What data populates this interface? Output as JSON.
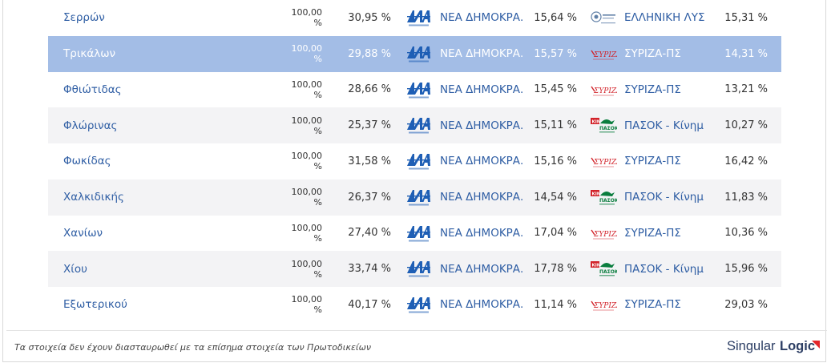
{
  "rows": [
    {
      "region": "Σερρών",
      "counted": "100,00 %",
      "turnout": "30,95 %",
      "first_party": {
        "logo": "nd-logo",
        "name": "ΝΕΑ ΔΗΜΟΚΡΑ...",
        "pct": "15,64 %"
      },
      "second_party": {
        "logo": "elliniki-lysi-logo",
        "name": "ΕΛΛΗΝΙΚΗ ΛΥΣ...",
        "pct": "15,31 %"
      },
      "state": "default"
    },
    {
      "region": "Τρικάλων",
      "counted": "100,00 %",
      "turnout": "29,88 %",
      "first_party": {
        "logo": "nd-logo",
        "name": "ΝΕΑ ΔΗΜΟΚΡΑ...",
        "pct": "15,57 %"
      },
      "second_party": {
        "logo": "syriza-logo",
        "name": "ΣΥΡΙΖΑ-ΠΣ",
        "pct": "14,31 %"
      },
      "state": "selected"
    },
    {
      "region": "Φθιώτιδας",
      "counted": "100,00 %",
      "turnout": "28,66 %",
      "first_party": {
        "logo": "nd-logo",
        "name": "ΝΕΑ ΔΗΜΟΚΡΑ...",
        "pct": "15,45 %"
      },
      "second_party": {
        "logo": "syriza-logo",
        "name": "ΣΥΡΙΖΑ-ΠΣ",
        "pct": "13,21 %"
      },
      "state": "default"
    },
    {
      "region": "Φλώρινας",
      "counted": "100,00 %",
      "turnout": "25,37 %",
      "first_party": {
        "logo": "nd-logo",
        "name": "ΝΕΑ ΔΗΜΟΚΡΑ...",
        "pct": "15,11 %"
      },
      "second_party": {
        "logo": "pasok-logo",
        "name": "ΠΑΣΟΚ - Κίνημ...",
        "pct": "10,27 %"
      },
      "state": "alt"
    },
    {
      "region": "Φωκίδας",
      "counted": "100,00 %",
      "turnout": "31,58 %",
      "first_party": {
        "logo": "nd-logo",
        "name": "ΝΕΑ ΔΗΜΟΚΡΑ...",
        "pct": "15,16 %"
      },
      "second_party": {
        "logo": "syriza-logo",
        "name": "ΣΥΡΙΖΑ-ΠΣ",
        "pct": "16,42 %"
      },
      "state": "default"
    },
    {
      "region": "Χαλκιδικής",
      "counted": "100,00 %",
      "turnout": "26,37 %",
      "first_party": {
        "logo": "nd-logo",
        "name": "ΝΕΑ ΔΗΜΟΚΡΑ...",
        "pct": "14,54 %"
      },
      "second_party": {
        "logo": "pasok-logo",
        "name": "ΠΑΣΟΚ - Κίνημ...",
        "pct": "11,83 %"
      },
      "state": "alt"
    },
    {
      "region": "Χανίων",
      "counted": "100,00 %",
      "turnout": "27,40 %",
      "first_party": {
        "logo": "nd-logo",
        "name": "ΝΕΑ ΔΗΜΟΚΡΑ...",
        "pct": "17,04 %"
      },
      "second_party": {
        "logo": "syriza-logo",
        "name": "ΣΥΡΙΖΑ-ΠΣ",
        "pct": "10,36 %"
      },
      "state": "default"
    },
    {
      "region": "Χίου",
      "counted": "100,00 %",
      "turnout": "33,74 %",
      "first_party": {
        "logo": "nd-logo",
        "name": "ΝΕΑ ΔΗΜΟΚΡΑ...",
        "pct": "17,78 %"
      },
      "second_party": {
        "logo": "pasok-logo",
        "name": "ΠΑΣΟΚ - Κίνημ...",
        "pct": "15,96 %"
      },
      "state": "alt"
    },
    {
      "region": "Εξωτερικού",
      "counted": "100,00 %",
      "turnout": "40,17 %",
      "first_party": {
        "logo": "nd-logo",
        "name": "ΝΕΑ ΔΗΜΟΚΡΑ...",
        "pct": "11,14 %"
      },
      "second_party": {
        "logo": "syriza-logo",
        "name": "ΣΥΡΙΖΑ-ΠΣ",
        "pct": "29,03 %"
      },
      "state": "default"
    }
  ],
  "footer": {
    "disclaimer": "Τα στοιχεία δεν έχουν διασταυρωθεί με τα επίσημα στοιχεία των Πρωτοδικείων",
    "brand_part1": "Singular",
    "brand_part2": "Logic"
  },
  "colors": {
    "link": "#2f5ea4",
    "selected_row": "#a3bde6",
    "alt_row": "#f3f3f5",
    "nd_blue": "#1f5fb5",
    "syriza_red": "#d2232a",
    "pasok_green": "#0a7d3e",
    "brand_accent": "#e3262a"
  }
}
